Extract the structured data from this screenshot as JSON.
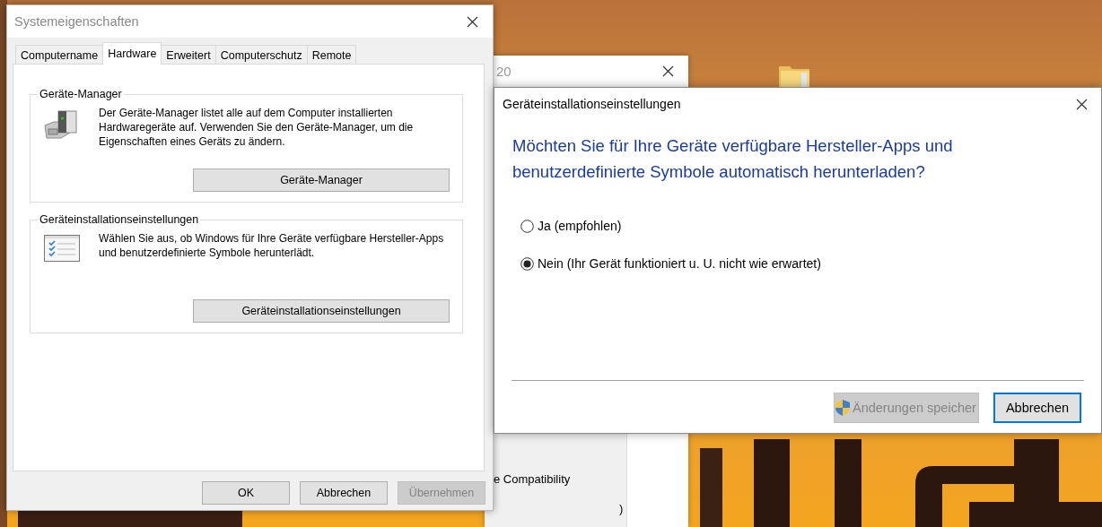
{
  "system_properties": {
    "title": "Systemeigenschaften",
    "tabs": [
      {
        "label": "Computername",
        "selected": false
      },
      {
        "label": "Hardware",
        "selected": true
      },
      {
        "label": "Erweitert",
        "selected": false
      },
      {
        "label": "Computerschutz",
        "selected": false
      },
      {
        "label": "Remote",
        "selected": false
      }
    ],
    "groups": [
      {
        "kind": "device-manager",
        "title": "Geräte-Manager",
        "description": "Der Geräte-Manager listet alle auf dem Computer installierten Hardwaregeräte auf. Verwenden Sie den Geräte-Manager, um die Eigenschaften eines Geräts zu ändern.",
        "button": "Geräte-Manager"
      },
      {
        "kind": "checklist",
        "title": "Geräteinstallationseinstellungen",
        "description": "Wählen Sie aus, ob Windows für Ihre Geräte verfügbare Hersteller-Apps und benutzerdefinierte Symbole herunterlädt.",
        "button": "Geräteinstallationseinstellungen"
      }
    ],
    "buttons": [
      {
        "label": "OK",
        "disabled": false
      },
      {
        "label": "Abbrechen",
        "disabled": false
      },
      {
        "label": "Übernehmen",
        "disabled": true
      }
    ]
  },
  "background_window": {
    "title": "20",
    "texts": [
      "e Compatibility",
      ")"
    ]
  },
  "device_installation_dialog": {
    "title": "Geräteinstallationseinstellungen",
    "question": "Möchten Sie für Ihre Geräte verfügbare Hersteller-Apps und benutzerdefinierte Symbole automatisch herunterladen?",
    "options": [
      {
        "label": "Ja (empfohlen)",
        "selected": false
      },
      {
        "label": "Nein (Ihr Gerät funktioniert u. U. nicht wie erwartet)",
        "selected": true
      }
    ],
    "buttons": [
      {
        "label": "Änderungen speicher",
        "disabled": true,
        "shield": true,
        "focused": false
      },
      {
        "label": "Abbrechen",
        "disabled": false,
        "shield": false,
        "focused": true
      }
    ]
  }
}
